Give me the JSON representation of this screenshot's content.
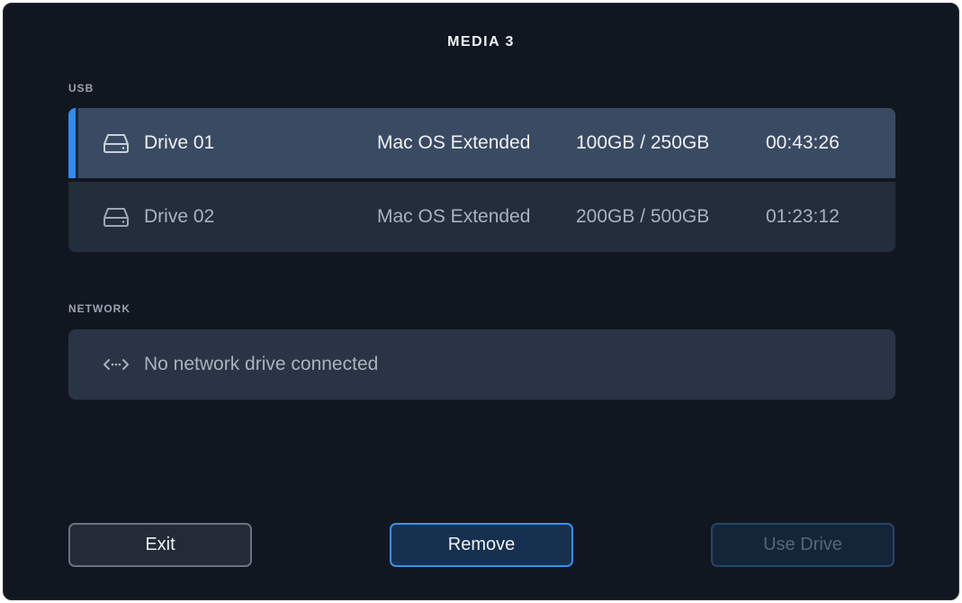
{
  "header": {
    "title": "MEDIA 3"
  },
  "usb": {
    "label": "USB",
    "selected_index": 0,
    "drives": [
      {
        "name": "Drive 01",
        "format": "Mac OS Extended",
        "capacity": "100GB / 250GB",
        "duration": "00:43:26",
        "icon": "hard-drive-icon"
      },
      {
        "name": "Drive 02",
        "format": "Mac OS Extended",
        "capacity": "200GB / 500GB",
        "duration": "01:23:12",
        "icon": "hard-drive-icon"
      }
    ]
  },
  "network": {
    "label": "NETWORK",
    "empty_message": "No network drive connected",
    "icon": "network-arrows-icon"
  },
  "buttons": {
    "exit_label": "Exit",
    "remove_label": "Remove",
    "use_drive_label": "Use Drive"
  },
  "colors": {
    "background": "#111720",
    "selected_row": "#3a4a62",
    "row": "#232d3c",
    "accent": "#2f8cf0"
  }
}
